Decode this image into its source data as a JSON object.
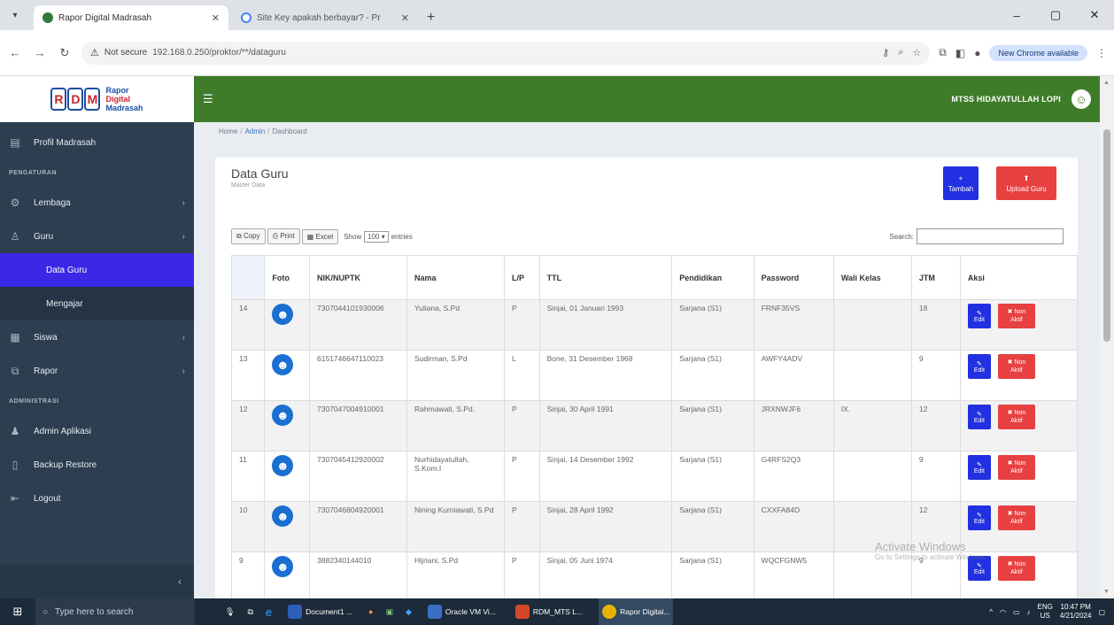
{
  "browser": {
    "tab_active_title": "Rapor Digital Madrasah",
    "tab_other_title": "Site Key apakah berbayar? - Pr",
    "new_tab_symbol": "+",
    "security_label": "Not secure",
    "url": "192.168.0.250/proktor/**/dataguru",
    "new_chrome_label": "New Chrome available"
  },
  "logo": {
    "line1": "Rapor",
    "line2": "Digital",
    "line3": "Madrasah",
    "letters": [
      "R",
      "D",
      "M"
    ]
  },
  "sidebar": {
    "profil": "Profil Madrasah",
    "section_pengaturan": "PENGATURAN",
    "lembaga": "Lembaga",
    "guru": "Guru",
    "data_guru": "Data Guru",
    "mengajar": "Mengajar",
    "siswa": "Siswa",
    "rapor": "Rapor",
    "section_administrasi": "ADMINISTRASI",
    "admin_aplikasi": "Admin Aplikasi",
    "backup": "Backup Restore",
    "logout": "Logout"
  },
  "topbar": {
    "school": "MTSS HIDAYATULLAH LOPI"
  },
  "breadcrumb": {
    "home": "Home",
    "admin": "Admin",
    "dashboard": "Dashboard"
  },
  "page": {
    "title": "Data Guru",
    "subtitle": "Master Data",
    "btn_tambah": "Tambah",
    "btn_upload": "Upload Guru"
  },
  "table_controls": {
    "copy": "Copy",
    "print": "Print",
    "excel": "Excel",
    "show_label": "Show",
    "show_value": "100",
    "entries_label": "entries",
    "search_label": "Search:"
  },
  "table": {
    "headers": [
      "",
      "Foto",
      "NIK/NUPTK",
      "Nama",
      "L/P",
      "TTL",
      "Pendidikan",
      "Password",
      "Wali Kelas",
      "JTM",
      "Aksi"
    ],
    "rows": [
      {
        "no": "14",
        "nik": "7307044101930006",
        "nama": "Yuliana, S.Pd",
        "lp": "P",
        "ttl": "Sinjai, 01 Januari 1993",
        "pendidikan": "Sarjana (S1)",
        "password": "FRNF35VS",
        "wali": "",
        "jtm": "18"
      },
      {
        "no": "13",
        "nik": "6151746647110023",
        "nama": "Sudirman, S.Pd",
        "lp": "L",
        "ttl": "Bone, 31 Desember 1968",
        "pendidikan": "Sarjana (S1)",
        "password": "AWFY4ADV",
        "wali": "",
        "jtm": "9"
      },
      {
        "no": "12",
        "nik": "7307047004910001",
        "nama": "Rahmawati, S.Pd.",
        "lp": "P",
        "ttl": "Sinjai, 30 April 1991",
        "pendidikan": "Sarjana (S1)",
        "password": "JRXNWJF6",
        "wali": "IX.",
        "jtm": "12"
      },
      {
        "no": "11",
        "nik": "7307045412920002",
        "nama": "Nurhidayatullah, S.Kom.I",
        "lp": "P",
        "ttl": "Sinjai, 14 Desember 1992",
        "pendidikan": "Sarjana (S1)",
        "password": "G4RFS2Q3",
        "wali": "",
        "jtm": "9"
      },
      {
        "no": "10",
        "nik": "7307046804920001",
        "nama": "Nining Kurniawati, S.Pd",
        "lp": "P",
        "ttl": "Sinjai, 28 April 1992",
        "pendidikan": "Sarjana (S1)",
        "password": "CXXFA84D",
        "wali": "",
        "jtm": "12"
      },
      {
        "no": "9",
        "nik": "3882340144010",
        "nama": "Hijriani, S.Pd",
        "lp": "P",
        "ttl": "Sinjai, 05 Juni 1974",
        "pendidikan": "Sarjana (S1)",
        "password": "WQCFGNW5",
        "wali": "",
        "jtm": "9"
      }
    ],
    "btn_edit": "Edit",
    "btn_non_line1": "Non",
    "btn_non_line2": "Aktif"
  },
  "watermark": {
    "line1": "Activate Windows",
    "line2": "Go to Settings to activate Windows."
  },
  "taskbar": {
    "search_placeholder": "Type here to search",
    "apps": [
      "Document1 ...",
      "Oracle VM Vi...",
      "RDM_MTS L...",
      "Rapor Digital..."
    ],
    "lang": "ENG",
    "region": "US",
    "time": "10:47 PM",
    "date": "4/21/2024"
  },
  "colors": {
    "topbar": "#3e7c2a",
    "sidebar": "#2c3e50",
    "primary": "#2130e0",
    "danger": "#e74040"
  }
}
